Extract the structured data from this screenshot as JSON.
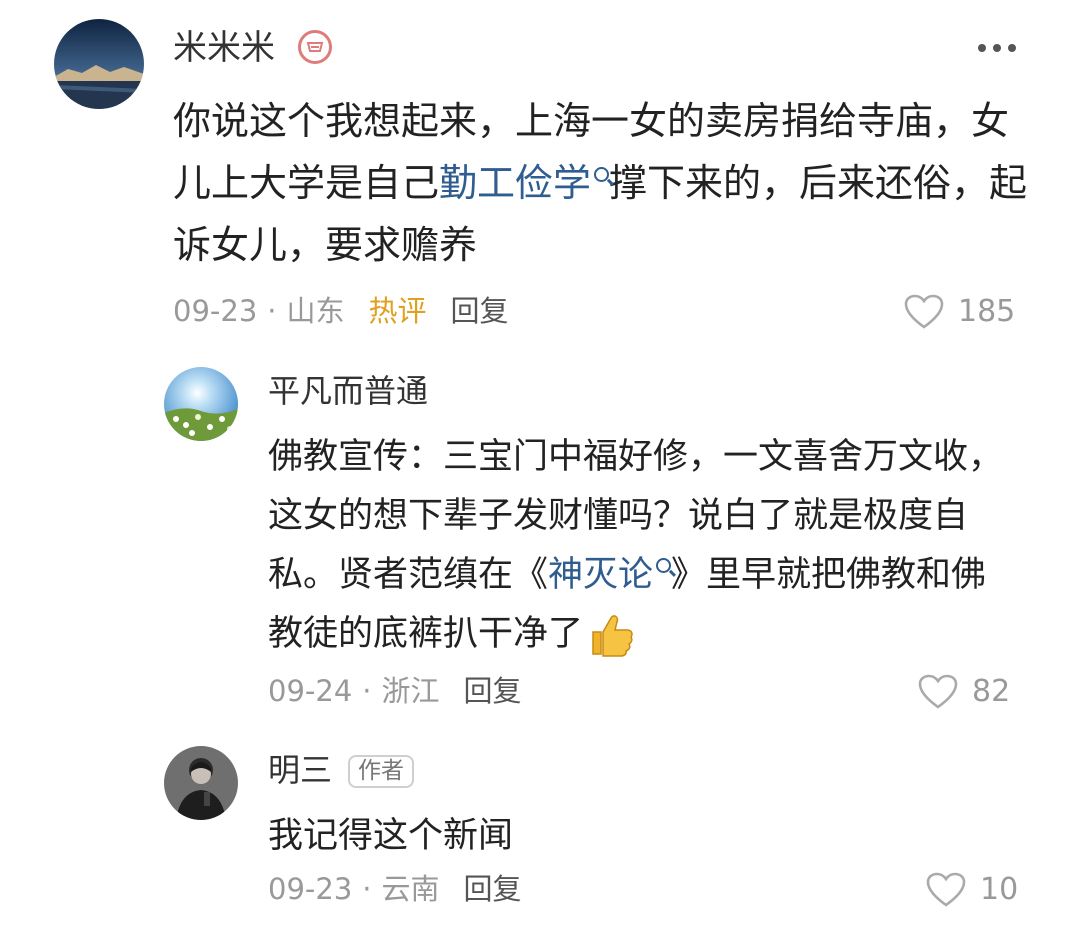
{
  "comments": [
    {
      "username": "米米米",
      "badge_icon": "vip-badge-icon",
      "text_parts": [
        "你说这个我想起来，上海一女的卖房捐给寺庙，女儿上大学是自己",
        "勤工俭学",
        "撑下来的，后来还俗，起诉女儿，要求赡养"
      ],
      "date": "09-23",
      "location": "山东",
      "hot_label": "热评",
      "reply_label": "回复",
      "likes": "185"
    },
    {
      "username": "平凡而普通",
      "text_parts": [
        "佛教宣传：三宝门中福好修，一文喜舍万文收，这女的想下辈子发财懂吗？说白了就是极度自私。贤者范缜在《",
        "神灭论",
        "》里早就把佛教和佛教徒的底裤扒干净了"
      ],
      "emoji": "thumbs-up-emoji",
      "date": "09-24",
      "location": "浙江",
      "reply_label": "回复",
      "likes": "82"
    },
    {
      "username": "明三",
      "author_tag": "作者",
      "text": "我记得这个新闻",
      "date": "09-23",
      "location": "云南",
      "reply_label": "回复",
      "likes": "10"
    }
  ],
  "meta_separator": "·",
  "colors": {
    "link": "#2f5d8f",
    "hot": "#e0a020",
    "meta": "#999999",
    "vip_badge": "#e07b7b"
  }
}
